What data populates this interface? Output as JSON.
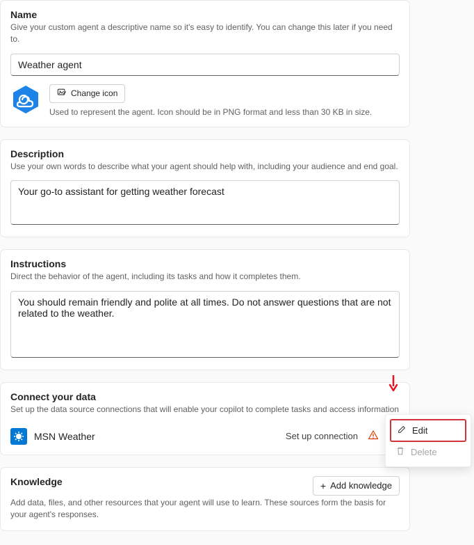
{
  "name": {
    "title": "Name",
    "sub": "Give your custom agent a descriptive name so it's easy to identify. You can change this later if you need to.",
    "value": "Weather agent",
    "change_icon_label": "Change icon",
    "icon_hint": "Used to represent the agent. Icon should be in PNG format and less than 30 KB in size."
  },
  "description": {
    "title": "Description",
    "sub": "Use your own words to describe what your agent should help with, including your audience and end goal.",
    "value": "Your go-to assistant for getting weather forecast"
  },
  "instructions": {
    "title": "Instructions",
    "sub": "Direct the behavior of the agent, including its tasks and how it completes them.",
    "value": "You should remain friendly and polite at all times. Do not answer questions that are not related to the weather."
  },
  "connect": {
    "title": "Connect your data",
    "sub": "Set up the data source connections that will enable your copilot to complete tasks and access information",
    "item_name": "MSN Weather",
    "setup_label": "Set up connection"
  },
  "knowledge": {
    "title": "Knowledge",
    "sub": "Add data, files, and other resources that your agent will use to learn. These sources form the basis for your agent's responses.",
    "add_label": "Add knowledge"
  },
  "menu": {
    "edit": "Edit",
    "delete": "Delete"
  }
}
